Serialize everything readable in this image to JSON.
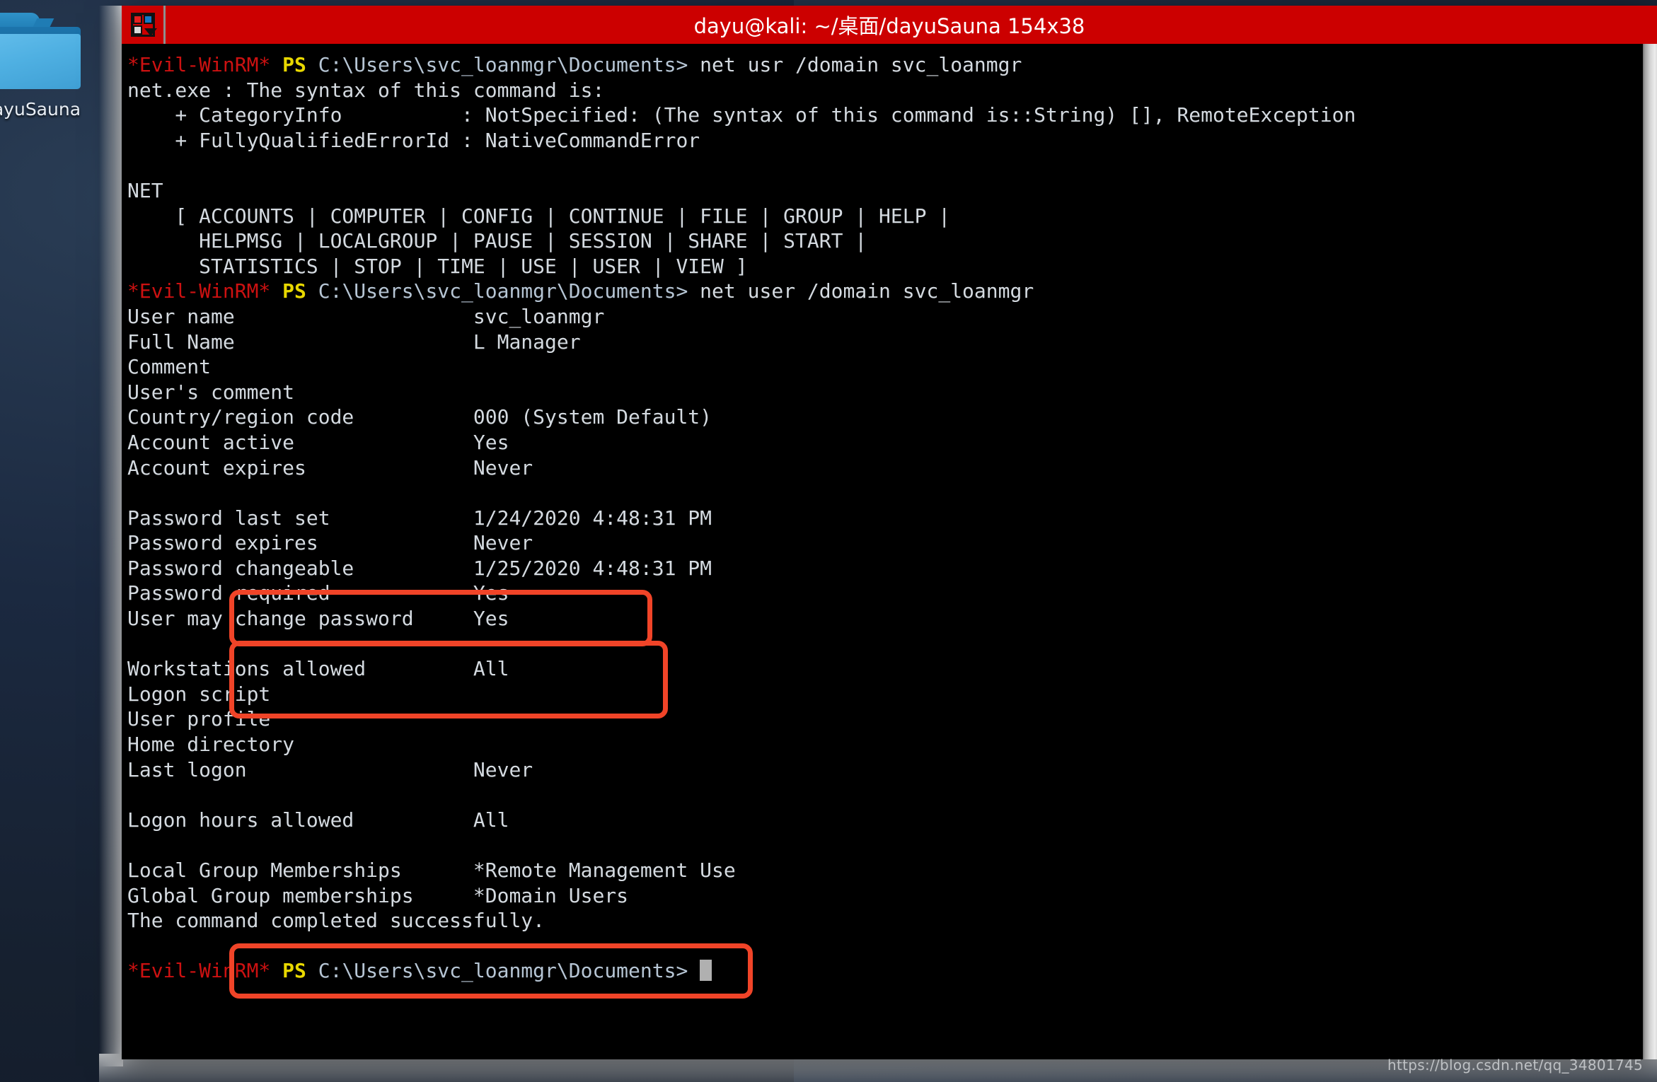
{
  "desktop": {
    "icon_label": "dayuSauna",
    "icon_name": "folder-icon",
    "watermark": "https://blog.csdn.net/qq_34801745",
    "background_color": "#16202f"
  },
  "window": {
    "title": "dayu@kali: ~/桌面/dayuSauna 154x38",
    "title_bar_color": "#cc0000",
    "title_bar_text_color": "#ffffff",
    "app_icon": "terminal-dropdown-icon",
    "terminal_background": "#000000"
  },
  "terminal": {
    "prompt_prefix": "*Evil-WinRM*",
    "prompt_ps": "PS",
    "prompt_path": "C:\\Users\\svc_loanmgr\\Documents>",
    "colors": {
      "prompt_prefix": "#cc1111",
      "prompt_ps": "#e8d800",
      "path": "#b6c5d4",
      "text": "#c8d0d8"
    },
    "lines": [
      {
        "type": "prompt",
        "command": " net usr /domain svc_loanmgr"
      },
      {
        "type": "out",
        "text": "net.exe : The syntax of this command is:"
      },
      {
        "type": "out",
        "text": "    + CategoryInfo          : NotSpecified: (The syntax of this command is::String) [], RemoteException"
      },
      {
        "type": "out",
        "text": "    + FullyQualifiedErrorId : NativeCommandError"
      },
      {
        "type": "out",
        "text": ""
      },
      {
        "type": "out",
        "text": "NET"
      },
      {
        "type": "out",
        "text": "    [ ACCOUNTS | COMPUTER | CONFIG | CONTINUE | FILE | GROUP | HELP |"
      },
      {
        "type": "out",
        "text": "      HELPMSG | LOCALGROUP | PAUSE | SESSION | SHARE | START |"
      },
      {
        "type": "out",
        "text": "      STATISTICS | STOP | TIME | USE | USER | VIEW ]"
      },
      {
        "type": "prompt",
        "command": " net user /domain svc_loanmgr"
      },
      {
        "type": "out",
        "text": "User name                    svc_loanmgr"
      },
      {
        "type": "out",
        "text": "Full Name                    L Manager"
      },
      {
        "type": "out",
        "text": "Comment"
      },
      {
        "type": "out",
        "text": "User's comment"
      },
      {
        "type": "out",
        "text": "Country/region code          000 (System Default)"
      },
      {
        "type": "out",
        "text": "Account active               Yes"
      },
      {
        "type": "out",
        "text": "Account expires              Never"
      },
      {
        "type": "out",
        "text": ""
      },
      {
        "type": "out",
        "text": "Password last set            1/24/2020 4:48:31 PM"
      },
      {
        "type": "out",
        "text": "Password expires             Never"
      },
      {
        "type": "out",
        "text": "Password changeable          1/25/2020 4:48:31 PM"
      },
      {
        "type": "out",
        "text": "Password required            Yes"
      },
      {
        "type": "out",
        "text": "User may change password     Yes"
      },
      {
        "type": "out",
        "text": ""
      },
      {
        "type": "out",
        "text": "Workstations allowed         All"
      },
      {
        "type": "out",
        "text": "Logon script"
      },
      {
        "type": "out",
        "text": "User profile"
      },
      {
        "type": "out",
        "text": "Home directory"
      },
      {
        "type": "out",
        "text": "Last logon                   Never"
      },
      {
        "type": "out",
        "text": ""
      },
      {
        "type": "out",
        "text": "Logon hours allowed          All"
      },
      {
        "type": "out",
        "text": ""
      },
      {
        "type": "out",
        "text": "Local Group Memberships      *Remote Management Use"
      },
      {
        "type": "out",
        "text": "Global Group memberships     *Domain Users"
      },
      {
        "type": "out",
        "text": "The command completed successfully."
      },
      {
        "type": "out",
        "text": ""
      },
      {
        "type": "prompt",
        "command": " ",
        "cursor": true
      }
    ]
  },
  "annotations": {
    "color": "#f04428",
    "boxes": [
      {
        "id": "password-expires-box",
        "label": "Password expires  Never"
      },
      {
        "id": "password-required-box",
        "label": "Password required / User may change password"
      },
      {
        "id": "global-group-memberships-box",
        "label": "Global Group memberships  *Domain Users"
      }
    ]
  }
}
